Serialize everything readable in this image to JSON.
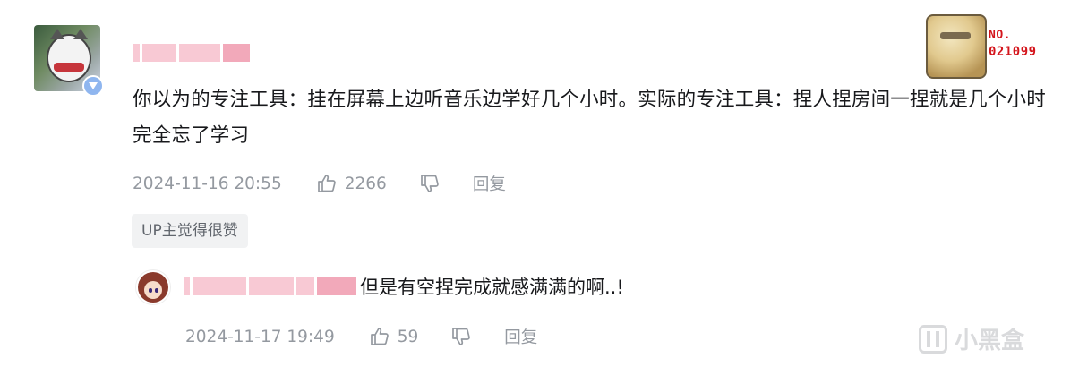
{
  "comment": {
    "author": "",
    "content": "你以为的专注工具：挂在屏幕上边听音乐边学好几个小时。实际的专注工具：捏人捏房间一捏就是几个小时完全忘了学习",
    "time": "2024-11-16 20:55",
    "likes": "2266",
    "reply_label": "回复",
    "tag": "UP主觉得很赞",
    "decoration": {
      "line1": "NO.",
      "line2": "021099"
    }
  },
  "sub_reply": {
    "author": "",
    "content": "但是有空捏完成就感满满的啊..!",
    "time": "2024-11-17 19:49",
    "likes": "59",
    "reply_label": "回复"
  },
  "watermark": {
    "text": "小黑盒"
  },
  "icons": {
    "like": "thumb-up-icon",
    "dislike": "thumb-down-icon"
  },
  "colors": {
    "accent": "#9499a0",
    "name_blur": "#f6b7c6",
    "badge": "#d4141b"
  }
}
